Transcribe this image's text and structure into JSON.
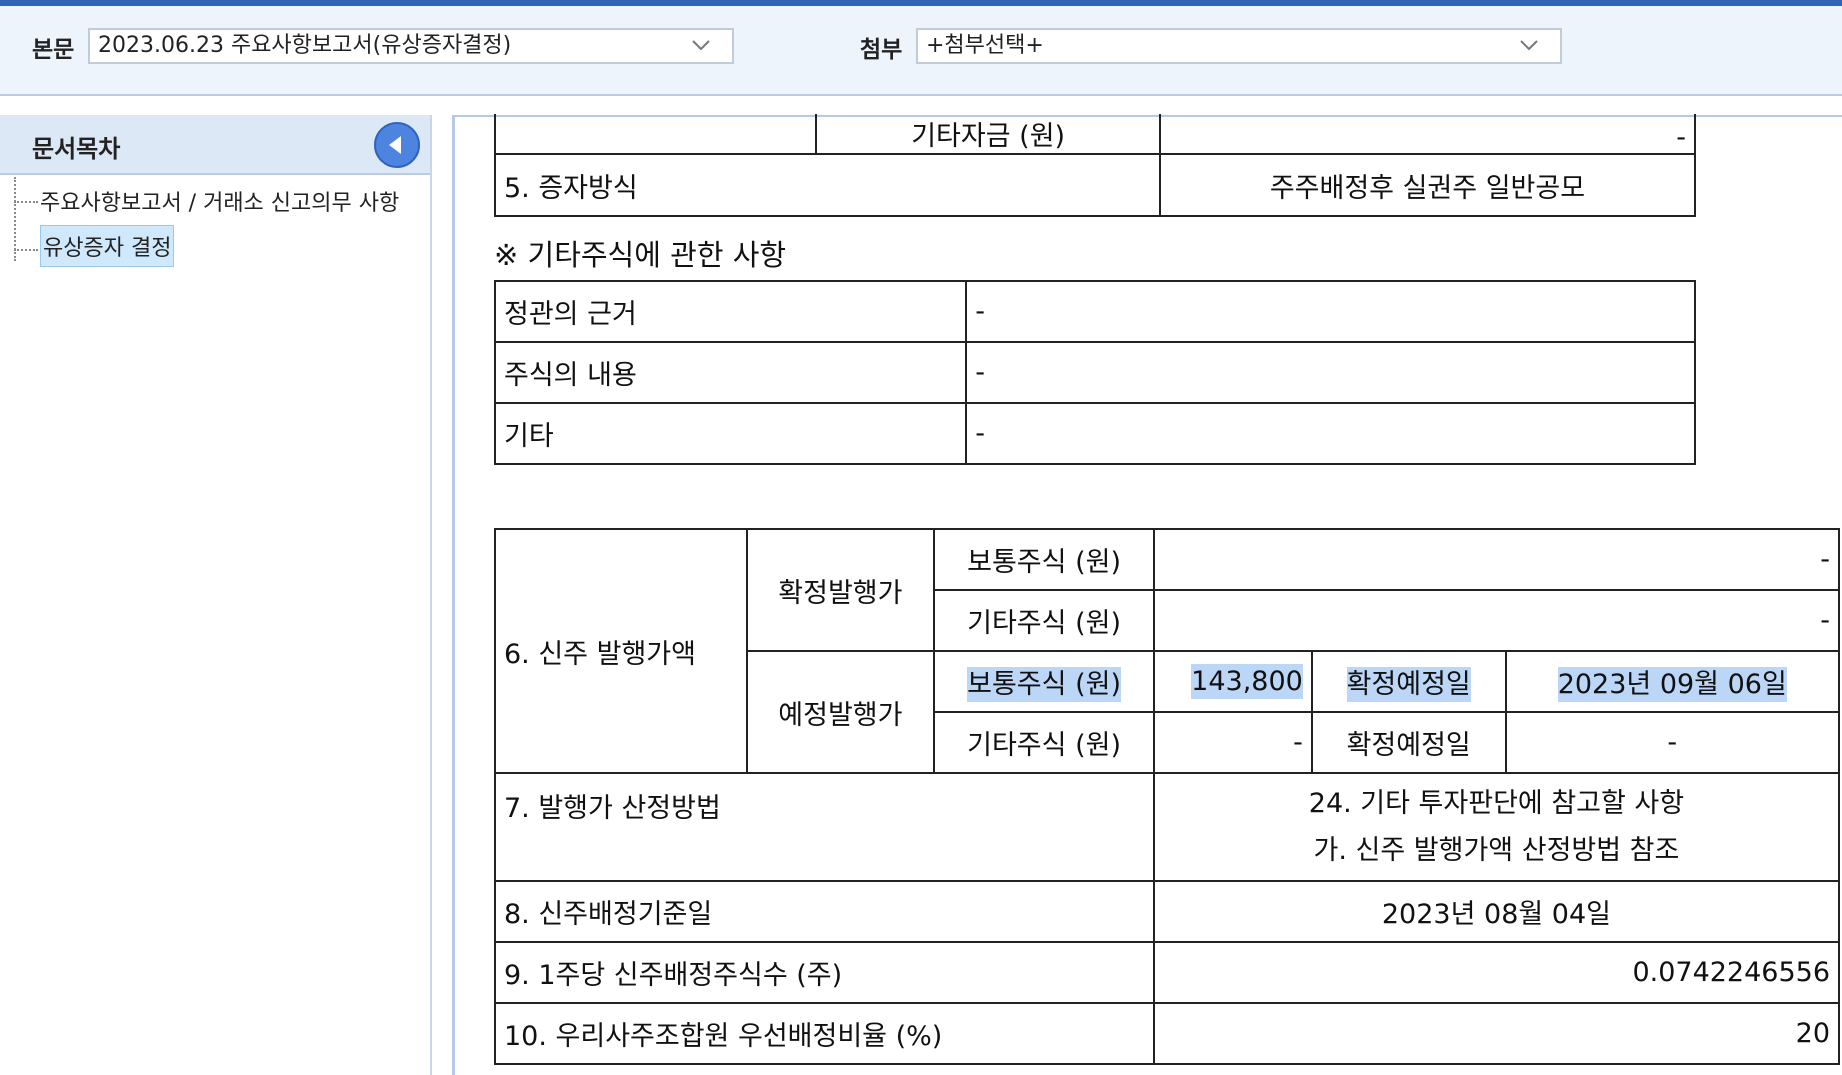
{
  "header": {
    "main_label": "본문",
    "main_select_value": "2023.06.23  주요사항보고서(유상증자결정)",
    "attach_label": "첨부",
    "attach_select_value": "+첨부선택+"
  },
  "sidebar": {
    "title": "문서목차",
    "items": [
      {
        "label": "주요사항보고서 / 거래소 신고의무 사항"
      },
      {
        "label": "유상증자 결정"
      }
    ]
  },
  "doc": {
    "table_top": {
      "row_cut": {
        "label": "기타자금 (원)",
        "value": "-"
      },
      "row5": {
        "label": "5. 증자방식",
        "value": "주주배정후 실권주 일반공모"
      }
    },
    "note": "※ 기타주식에 관한 사항",
    "other_shares": [
      {
        "label": "정관의 근거",
        "value": "-"
      },
      {
        "label": "주식의 내용",
        "value": "-"
      },
      {
        "label": "기타",
        "value": "-"
      }
    ],
    "price": {
      "label": "6. 신주 발행가액",
      "confirmed": {
        "label": "확정발행가",
        "common_label": "보통주식 (원)",
        "common_value": "-",
        "other_label": "기타주식 (원)",
        "other_value": "-"
      },
      "expected": {
        "label": "예정발행가",
        "common_label": "보통주식 (원)",
        "common_value": "143,800",
        "common_date_label": "확정예정일",
        "common_date": "2023년 09월 06일",
        "other_label": "기타주식 (원)",
        "other_value": "-",
        "other_date_label": "확정예정일",
        "other_date": "-"
      }
    },
    "row7": {
      "label": "7. 발행가 산정방법",
      "line1": "24. 기타 투자판단에 참고할 사항",
      "line2": "가. 신주 발행가액 산정방법 참조"
    },
    "row8": {
      "label": "8. 신주배정기준일",
      "value": "2023년 08월 04일"
    },
    "row9": {
      "label": "9. 1주당 신주배정주식수 (주)",
      "value": "0.0742246556"
    },
    "row10": {
      "label": "10. 우리사주조합원 우선배정비율 (%)",
      "value": "20"
    }
  }
}
